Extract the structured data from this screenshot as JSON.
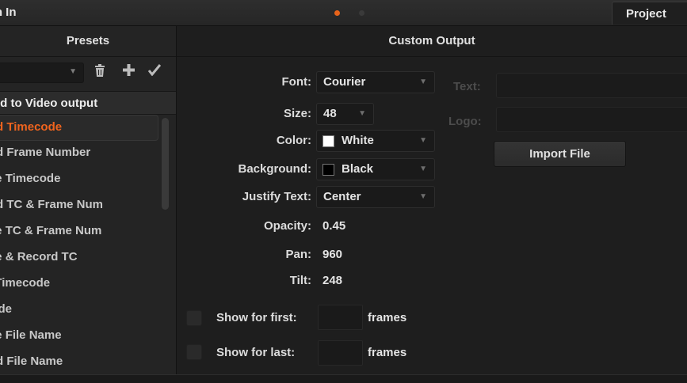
{
  "window": {
    "title": "rn In",
    "active_tab": "Project"
  },
  "presets_panel": {
    "header": "Presets",
    "select_value": "",
    "section_header": "ld to Video output",
    "items": [
      {
        "label": "ord Timecode",
        "selected": true
      },
      {
        "label": "ord Frame Number",
        "selected": false
      },
      {
        "label": "rce Timecode",
        "selected": false
      },
      {
        "label": "ord TC & Frame Num",
        "selected": false
      },
      {
        "label": "rce TC & Frame Num",
        "selected": false
      },
      {
        "label": "rce & Record TC",
        "selected": false
      },
      {
        "label": "o Timecode",
        "selected": false
      },
      {
        "label": "code",
        "selected": false
      },
      {
        "label": "rce File Name",
        "selected": false
      },
      {
        "label": "ord File Name",
        "selected": false
      }
    ]
  },
  "custom_output": {
    "header": "Custom Output",
    "font": {
      "label": "Font:",
      "value": "Courier"
    },
    "size": {
      "label": "Size:",
      "value": "48"
    },
    "color": {
      "label": "Color:",
      "value": "White",
      "swatch": "#ffffff"
    },
    "background": {
      "label": "Background:",
      "value": "Black",
      "swatch": "#000000"
    },
    "justify": {
      "label": "Justify Text:",
      "value": "Center"
    },
    "opacity": {
      "label": "Opacity:",
      "value": "0.45"
    },
    "pan": {
      "label": "Pan:",
      "value": "960"
    },
    "tilt": {
      "label": "Tilt:",
      "value": "248"
    },
    "show_first": {
      "label": "Show for first:",
      "value": "",
      "unit": "frames",
      "checked": false
    },
    "show_last": {
      "label": "Show for last:",
      "value": "",
      "unit": "frames",
      "checked": false
    },
    "text_label": "Text:",
    "logo_label": "Logo:",
    "import_label": "Import File"
  },
  "colors": {
    "accent": "#f0641e",
    "panel": "#242424",
    "background": "#1e1e1e"
  }
}
